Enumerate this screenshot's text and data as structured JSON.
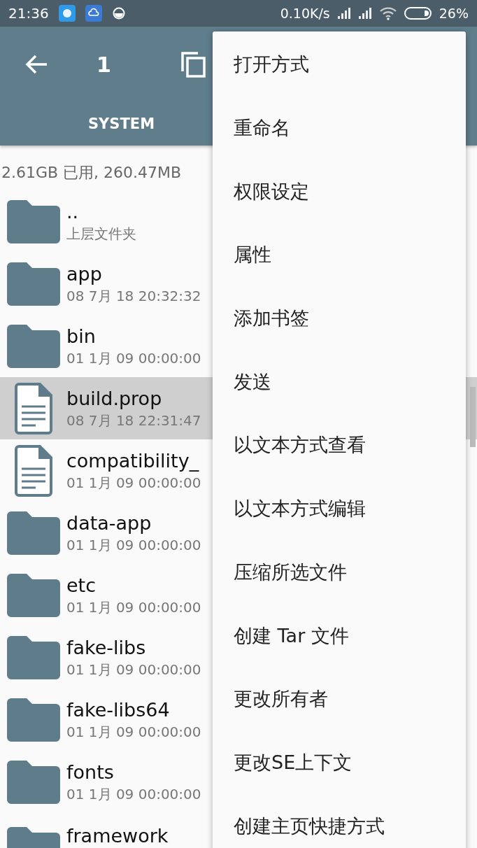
{
  "status_bar": {
    "time": "21:36",
    "speed": "0.10K/s",
    "battery": "26%"
  },
  "toolbar": {
    "count": "1"
  },
  "tabs": [
    {
      "label": "SYSTEM",
      "selected": true
    }
  ],
  "storage": "2.61GB 已用, 260.47MB",
  "files": [
    {
      "kind": "folder",
      "name": "..",
      "detail": "上层文件夹",
      "selected": false
    },
    {
      "kind": "folder",
      "name": "app",
      "detail": "08 7月 18 20:32:32",
      "selected": false
    },
    {
      "kind": "folder",
      "name": "bin",
      "detail": "01 1月 09 00:00:00",
      "selected": false
    },
    {
      "kind": "file",
      "name": "build.prop",
      "detail": "08 7月 18 22:31:47",
      "selected": true
    },
    {
      "kind": "file",
      "name": "compatibility_",
      "detail": "01 1月 09 00:00:00",
      "selected": false
    },
    {
      "kind": "folder",
      "name": "data-app",
      "detail": "01 1月 09 00:00:00",
      "selected": false
    },
    {
      "kind": "folder",
      "name": "etc",
      "detail": "01 1月 09 00:00:00",
      "selected": false
    },
    {
      "kind": "folder",
      "name": "fake-libs",
      "detail": "01 1月 09 00:00:00",
      "selected": false
    },
    {
      "kind": "folder",
      "name": "fake-libs64",
      "detail": "01 1月 09 00:00:00",
      "selected": false
    },
    {
      "kind": "folder",
      "name": "fonts",
      "detail": "01 1月 09 00:00:00",
      "selected": false
    },
    {
      "kind": "folder",
      "name": "framework",
      "selected": false
    }
  ],
  "menu": [
    "打开方式",
    "重命名",
    "权限设定",
    "属性",
    "添加书签",
    "发送",
    "以文本方式查看",
    "以文本方式编辑",
    "压缩所选文件",
    "创建 Tar 文件",
    "更改所有者",
    "更改SE上下文",
    "创建主页快捷方式"
  ]
}
